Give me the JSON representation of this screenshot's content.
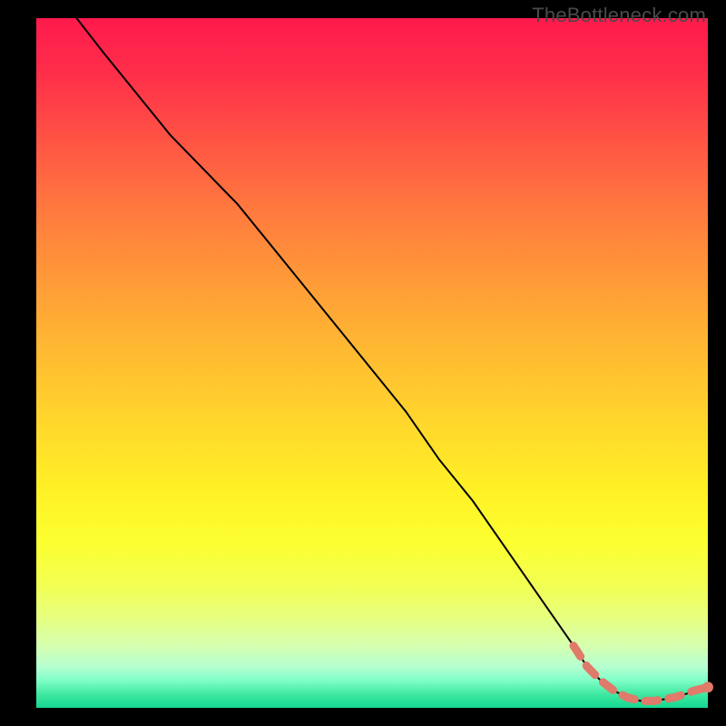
{
  "watermark": "TheBottleneck.com",
  "chart_data": {
    "type": "line",
    "title": "",
    "xlabel": "",
    "ylabel": "",
    "xlim": [
      0,
      100
    ],
    "ylim": [
      0,
      100
    ],
    "series": [
      {
        "name": "main-curve",
        "style": "solid-thin-black",
        "x": [
          6,
          10,
          15,
          20,
          25,
          28,
          30,
          35,
          40,
          45,
          50,
          55,
          60,
          65,
          70,
          75,
          80,
          82,
          84,
          86,
          88,
          90,
          92,
          95,
          100
        ],
        "y": [
          100,
          95,
          89,
          83,
          78,
          75,
          73,
          67,
          61,
          55,
          49,
          43,
          36,
          30,
          23,
          16,
          9,
          6,
          4,
          2.5,
          1.5,
          1,
          1,
          1.5,
          3
        ]
      },
      {
        "name": "highlight-segment",
        "style": "dashed-thick-salmon",
        "x": [
          80,
          82,
          84,
          86,
          88,
          90,
          92,
          95,
          98,
          100
        ],
        "y": [
          9,
          6,
          4,
          2.5,
          1.5,
          1,
          1,
          1.5,
          2.5,
          3
        ]
      }
    ],
    "highlight_endpoint": {
      "x": 100,
      "y": 3
    },
    "gradient_stops": [
      {
        "pos": 0,
        "color": "#ff1a4d"
      },
      {
        "pos": 50,
        "color": "#ffd52c"
      },
      {
        "pos": 80,
        "color": "#fcff30"
      },
      {
        "pos": 100,
        "color": "#14d890"
      }
    ]
  }
}
